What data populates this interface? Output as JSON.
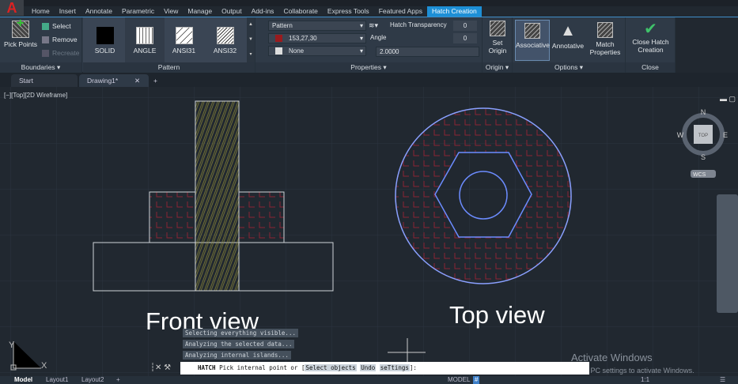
{
  "ribbon_tabs": [
    "Home",
    "Insert",
    "Annotate",
    "Parametric",
    "View",
    "Manage",
    "Output",
    "Add-ins",
    "Collaborate",
    "Express Tools",
    "Featured Apps",
    "Hatch Creation"
  ],
  "active_tab": "Hatch Creation",
  "boundaries": {
    "pick_points": "Pick Points",
    "select": "Select",
    "remove": "Remove",
    "recreate": "Recreate",
    "title": "Boundaries"
  },
  "pattern": {
    "items": [
      "SOLID",
      "ANGLE",
      "ANSI31",
      "ANSI32"
    ],
    "title": "Pattern"
  },
  "properties": {
    "type": "Pattern",
    "color": "153,27,30",
    "color_hex": "#991b1e",
    "background": "None",
    "transparency_label": "Hatch Transparency",
    "transparency": "0",
    "angle_label": "Angle",
    "angle": "0",
    "scale": "2.0000",
    "title": "Properties"
  },
  "origin": {
    "set_origin": "Set Origin",
    "title": "Origin"
  },
  "options": {
    "associative": "Associative",
    "annotative": "Annotative",
    "match_properties": "Match Properties",
    "title": "Options"
  },
  "close": {
    "label": "Close Hatch Creation",
    "title": "Close"
  },
  "file_tabs": [
    "Start",
    "Drawing1*"
  ],
  "viewport_label": "[−][Top][2D Wireframe]",
  "viewcube": {
    "n": "N",
    "s": "S",
    "e": "E",
    "w": "W",
    "face": "TOP",
    "ucs": "WCS"
  },
  "drawing": {
    "front_label": "Front view",
    "top_label": "Top view",
    "hatch_color": "#991b1e",
    "hatch2_color": "#b5a940"
  },
  "messages": [
    "Selecting everything visible...",
    "Analyzing the selected data...",
    "Analyzing internal islands..."
  ],
  "command": {
    "name": "HATCH",
    "prompt": "Pick internal point or [",
    "opt1": "Select objects",
    "opt2": "Undo",
    "opt3": "seTtings",
    "end": "]:"
  },
  "watermark": {
    "title": "Activate Windows",
    "sub": "Go to PC settings to activate Windows."
  },
  "layout_tabs": [
    "Model",
    "Layout1",
    "Layout2"
  ],
  "status": {
    "model": "MODEL",
    "scale": "1:1"
  },
  "ucs": {
    "x": "X",
    "y": "Y"
  }
}
